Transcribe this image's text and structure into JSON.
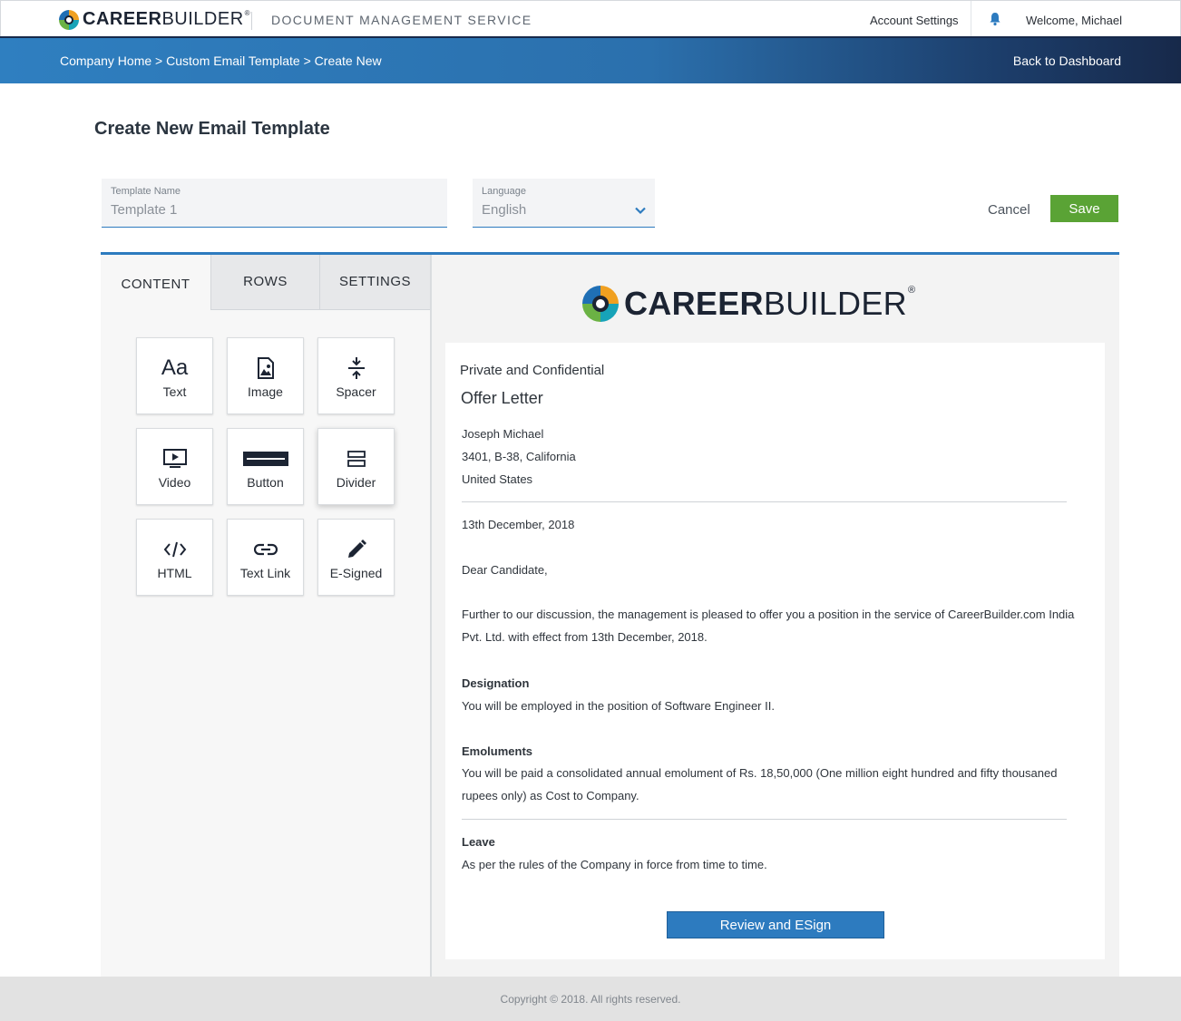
{
  "header": {
    "logo_bold": "CAREER",
    "logo_light": "BUILDER",
    "logo_reg": "®",
    "service_title": "DOCUMENT MANAGEMENT SERVICE",
    "account_settings": "Account Settings",
    "welcome": "Welcome, Michael",
    "bell_icon": "bell-icon"
  },
  "breadcrumb": {
    "items": [
      "Company Home",
      "Custom Email Template",
      "Create New"
    ],
    "separator": " > ",
    "back_link": "Back to Dashboard"
  },
  "page": {
    "title": "Create New Email Template"
  },
  "form": {
    "template_name_label": "Template Name",
    "template_name_value": "Template 1",
    "language_label": "Language",
    "language_value": "English",
    "cancel_label": "Cancel",
    "save_label": "Save"
  },
  "editor": {
    "tabs": [
      {
        "label": "CONTENT",
        "active": true
      },
      {
        "label": "ROWS",
        "active": false
      },
      {
        "label": "SETTINGS",
        "active": false
      }
    ],
    "tiles": [
      {
        "label": "Text",
        "icon": "text-aa-icon"
      },
      {
        "label": "Image",
        "icon": "image-icon"
      },
      {
        "label": "Spacer",
        "icon": "spacer-icon"
      },
      {
        "label": "Video",
        "icon": "video-icon"
      },
      {
        "label": "Button",
        "icon": "button-icon"
      },
      {
        "label": "Divider",
        "icon": "divider-icon"
      },
      {
        "label": "HTML",
        "icon": "code-icon"
      },
      {
        "label": "Text Link",
        "icon": "link-icon"
      },
      {
        "label": "E-Signed",
        "icon": "pencil-icon"
      }
    ],
    "text_icon_glyph": "Aa"
  },
  "letter": {
    "confidential": "Private and Confidential",
    "heading": "Offer Letter",
    "address": [
      "Joseph Michael",
      "3401, B-38, California",
      "United States"
    ],
    "date": "13th December, 2018",
    "salutation": "Dear Candidate,",
    "intro": "Further to our discussion, the management is pleased to offer you a position in the service of CareerBuilder.com India Pvt. Ltd. with effect from 13th December, 2018.",
    "designation_title": "Designation",
    "designation_text": "You will be employed in the position of Software Engineer II.",
    "emoluments_title": "Emoluments",
    "emoluments_text": "You will be paid a consolidated annual emolument of Rs. 18,50,000 (One million eight hundred and fifty thousaned rupees only) as Cost to Company.",
    "leave_title": "Leave",
    "leave_text": "As per the rules of the Company in force from time to time.",
    "esign_button": "Review and ESign"
  },
  "footer": {
    "copyright": "Copyright © 2018. All rights reserved."
  },
  "colors": {
    "primary_blue": "#2d7bbf",
    "navy": "#1c2433",
    "save_green": "#5aa335"
  }
}
